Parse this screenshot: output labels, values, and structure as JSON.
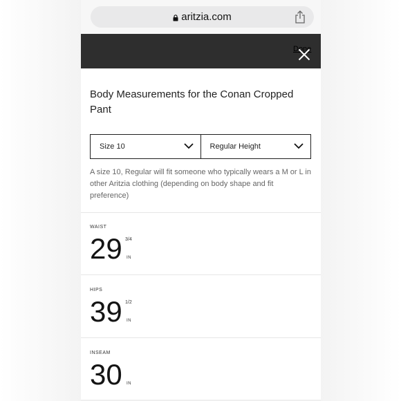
{
  "browser": {
    "url": "aritzia.com",
    "lock_icon": "lock-icon",
    "share_icon": "share-icon"
  },
  "modal": {
    "done_label": "Done",
    "close_icon": "close-icon",
    "title": "Body Measurements for the Conan Cropped Pant",
    "size_select": {
      "selected": "Size 10"
    },
    "height_select": {
      "selected": "Regular Height"
    },
    "description": "A size 10, Regular will fit someone who typically wears a M or L in other Aritzia clothing (depending on body shape and fit preference)",
    "measurements": [
      {
        "label": "WAIST",
        "value": "29",
        "fraction": "3/4",
        "unit": "IN"
      },
      {
        "label": "HIPS",
        "value": "39",
        "fraction": "1/2",
        "unit": "IN"
      },
      {
        "label": "INSEAM",
        "value": "30",
        "fraction": "",
        "unit": "IN"
      }
    ]
  },
  "colors": {
    "header_bar": "#2e2e2e",
    "text_primary": "#222222",
    "text_secondary": "#666666",
    "border": "#1f1f1f"
  }
}
